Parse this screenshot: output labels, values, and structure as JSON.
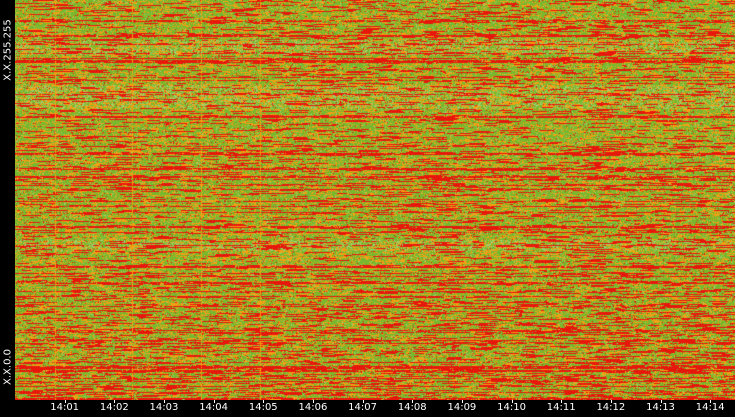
{
  "chart_data": {
    "type": "heatmap",
    "title": "",
    "xlabel": "",
    "ylabel": "",
    "x_tick_labels": [
      "14:01",
      "14:02",
      "14:03",
      "14:04",
      "14:05",
      "14:06",
      "14:07",
      "14:08",
      "14:09",
      "14:10",
      "14:11",
      "14:12",
      "14:13",
      "14:14"
    ],
    "x_range": [
      "14:00",
      "14:14:30"
    ],
    "y_tick_labels": {
      "top": "X.X.255.255",
      "bottom": "X.X.0.0"
    },
    "grid": false,
    "legend": "none",
    "colors": {
      "background": "#000000",
      "green": "#77b82e",
      "light_green": "#9fd071",
      "orange": "#f2a015",
      "red": "#e8170c"
    }
  }
}
